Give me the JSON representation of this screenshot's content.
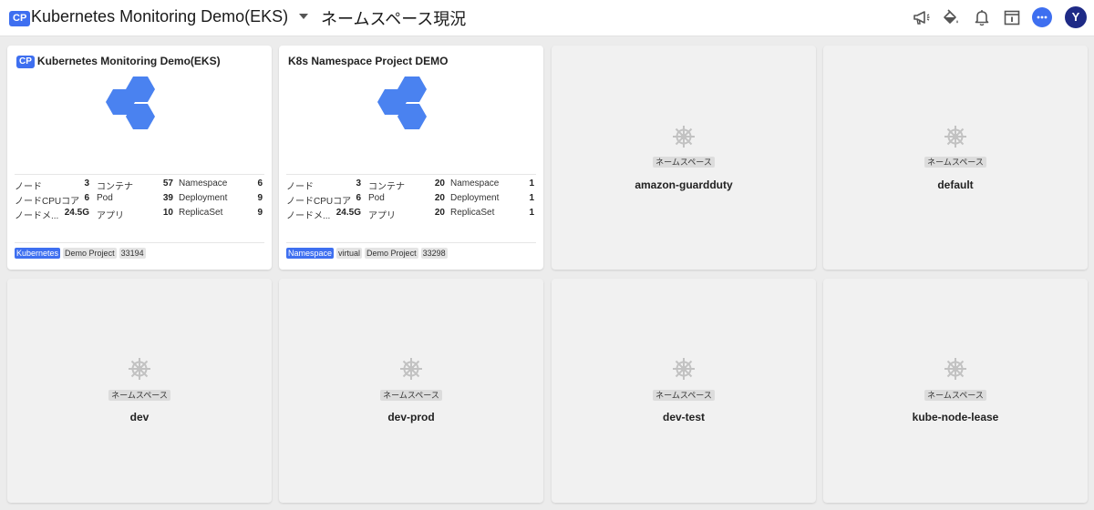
{
  "header": {
    "cp_badge": "CP",
    "project_title": "Kubernetes Monitoring Demo(EKS)",
    "page_title": "ネームスペース現況",
    "icons": [
      "megaphone-icon",
      "paint-bucket-icon",
      "bell-icon",
      "calendar-icon",
      "chat-icon"
    ],
    "avatar_letter": "Y"
  },
  "project_cards": [
    {
      "badge": "CP",
      "title": "Kubernetes Monitoring Demo(EKS)",
      "stats": [
        {
          "label": "ノード",
          "value": "3"
        },
        {
          "label": "ノードCPUコア",
          "value": "6"
        },
        {
          "label": "ノードメ...",
          "value": "24.5G"
        },
        {
          "label": "コンテナ",
          "value": "57"
        },
        {
          "label": "Pod",
          "value": "39"
        },
        {
          "label": "アプリ",
          "value": "10"
        },
        {
          "label": "Namespace",
          "value": "6"
        },
        {
          "label": "Deployment",
          "value": "9"
        },
        {
          "label": "ReplicaSet",
          "value": "9"
        }
      ],
      "tags": [
        "Kubernetes",
        "Demo Project",
        "33194"
      ]
    },
    {
      "title": "K8s Namespace Project DEMO",
      "stats": [
        {
          "label": "ノード",
          "value": "3"
        },
        {
          "label": "ノードCPUコア",
          "value": "6"
        },
        {
          "label": "ノードメ...",
          "value": "24.5G"
        },
        {
          "label": "コンテナ",
          "value": "20"
        },
        {
          "label": "Pod",
          "value": "20"
        },
        {
          "label": "アプリ",
          "value": "20"
        },
        {
          "label": "Namespace",
          "value": "1"
        },
        {
          "label": "Deployment",
          "value": "1"
        },
        {
          "label": "ReplicaSet",
          "value": "1"
        }
      ],
      "tags": [
        "Namespace",
        "virtual",
        "Demo Project",
        "33298"
      ]
    }
  ],
  "namespace_cards": [
    {
      "label": "ネームスペース",
      "name": "amazon-guardduty"
    },
    {
      "label": "ネームスペース",
      "name": "default"
    },
    {
      "label": "ネームスペース",
      "name": "dev"
    },
    {
      "label": "ネームスペース",
      "name": "dev-prod"
    },
    {
      "label": "ネームスペース",
      "name": "dev-test"
    },
    {
      "label": "ネームスペース",
      "name": "kube-node-lease"
    }
  ],
  "colors": {
    "accent": "#3e6ff0",
    "hexagon": "#4a82f0",
    "avatar": "#1e2a86",
    "background": "#ececec",
    "namespace_card": "#f1f1f1"
  }
}
